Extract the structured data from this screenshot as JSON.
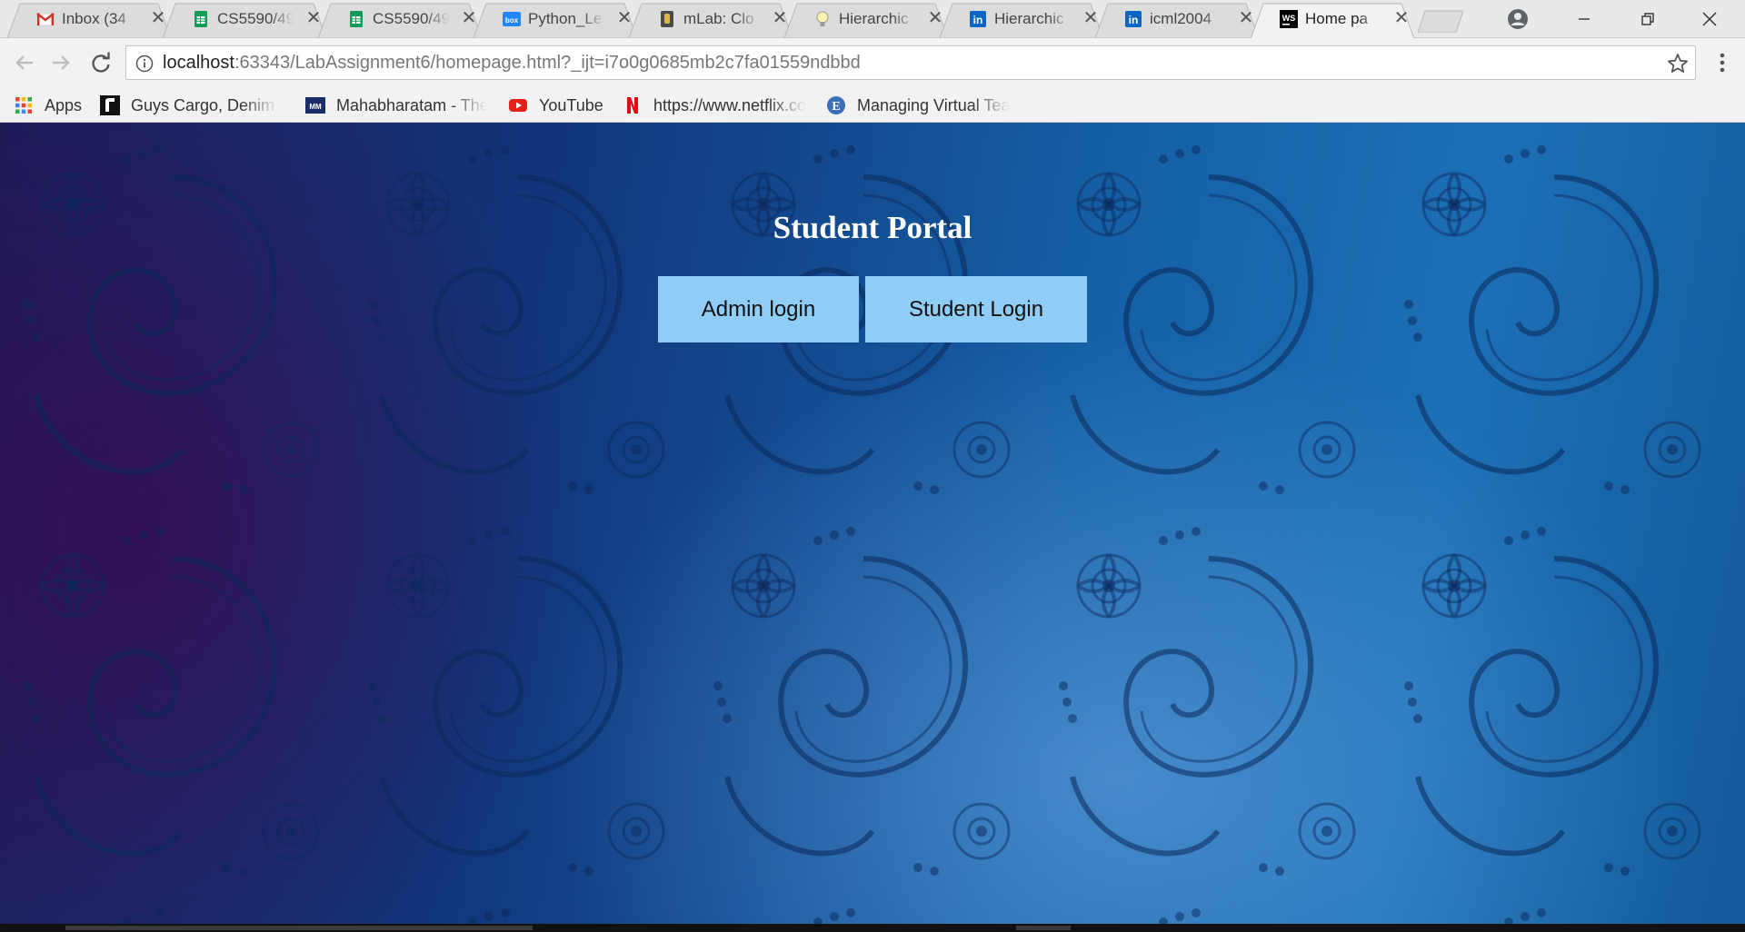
{
  "tabs": [
    {
      "title": "Inbox (34",
      "icon": "gmail-icon",
      "active": false
    },
    {
      "title": "CS5590/49",
      "icon": "sheets-icon",
      "active": false
    },
    {
      "title": "CS5590/49",
      "icon": "sheets-icon",
      "active": false
    },
    {
      "title": "Python_Le",
      "icon": "box-icon",
      "active": false
    },
    {
      "title": "mLab: Clo",
      "icon": "mlab-icon",
      "active": false
    },
    {
      "title": "Hierarchic",
      "icon": "bulb-icon",
      "active": false
    },
    {
      "title": "Hierarchic",
      "icon": "linkedin-icon",
      "active": false
    },
    {
      "title": "icml2004",
      "icon": "linkedin-icon",
      "active": false
    },
    {
      "title": "Home pa",
      "icon": "webstorm-icon",
      "active": true
    }
  ],
  "toolbar": {
    "url_host": "localhost",
    "url_rest": ":63343/LabAssignment6/homepage.html?_ijt=i7o0g0685mb2c7fa01559ndbbd"
  },
  "bookmarks": [
    {
      "label": "Apps",
      "icon": "apps-grid-icon"
    },
    {
      "label": "Guys Cargo, Denim &",
      "icon": "guys-cargo-icon"
    },
    {
      "label": "Mahabharatam - The",
      "icon": "mahabharatam-icon"
    },
    {
      "label": "YouTube",
      "icon": "youtube-icon"
    },
    {
      "label": "https://www.netflix.co",
      "icon": "netflix-icon"
    },
    {
      "label": "Managing Virtual Tea",
      "icon": "e-icon"
    }
  ],
  "page": {
    "title": "Student Portal",
    "admin_button": "Admin login",
    "student_button": "Student Login"
  },
  "colors": {
    "button_bg": "#8fcdf6",
    "page_bg_blue": "#1560a6",
    "page_bg_purple": "#3c0a50"
  }
}
